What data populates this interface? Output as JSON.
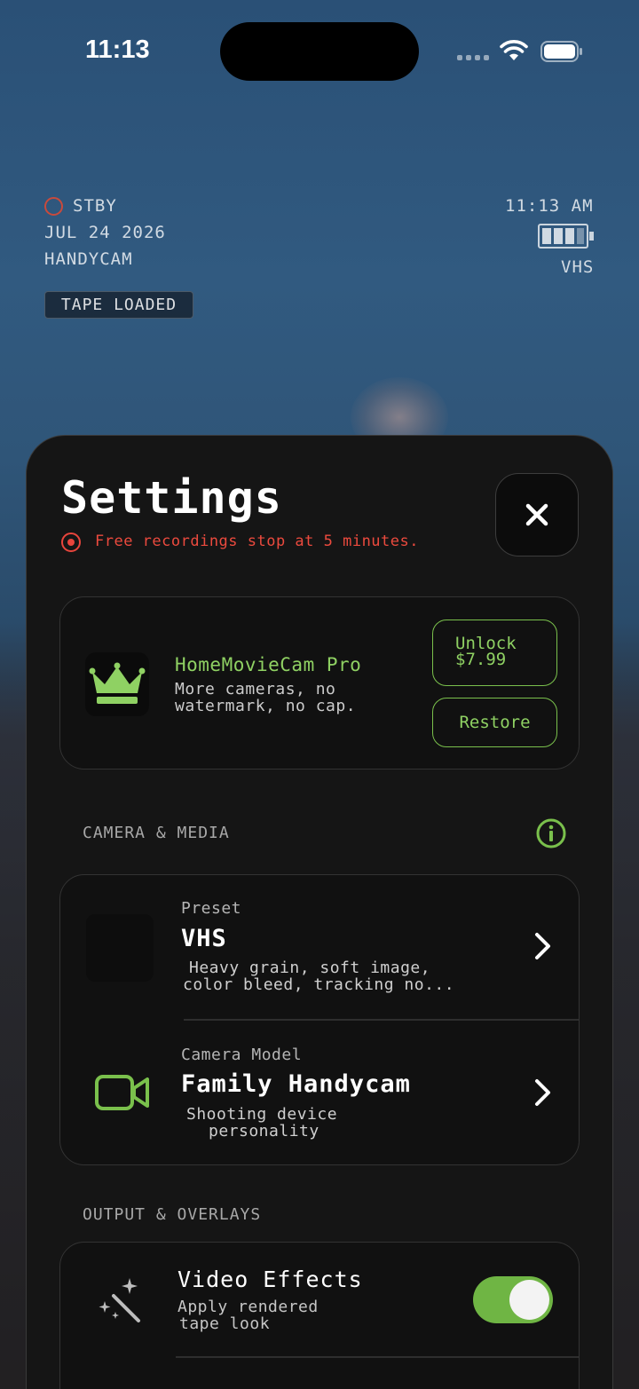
{
  "status_bar": {
    "time": "11:13"
  },
  "hud": {
    "mode": "STBY",
    "date": "JUL 24 2026",
    "camera": "HANDYCAM",
    "tape_badge": "TAPE LOADED",
    "clock": "11:13 AM",
    "format": "VHS"
  },
  "sheet": {
    "title": "Settings",
    "free_notice": "Free recordings stop at 5 minutes.",
    "pro": {
      "title": "HomeMovieCam Pro",
      "description": "More cameras, no watermark, no cap.",
      "unlock_label": "Unlock",
      "unlock_price": "$7.99",
      "restore_label": "Restore"
    },
    "camera_section": {
      "label": "CAMERA & MEDIA",
      "preset": {
        "label": "Preset",
        "value": "VHS",
        "description_line1": "Heavy grain, soft image,",
        "description_line2": "color bleed, tracking no..."
      },
      "camera_model": {
        "label": "Camera Model",
        "value": "Family Handycam",
        "description_line1": "Shooting device",
        "description_line2": "personality"
      }
    },
    "output_section": {
      "label": "OUTPUT & OVERLAYS",
      "video_effects": {
        "title": "Video Effects",
        "description_line1": "Apply rendered",
        "description_line2": "tape look",
        "enabled": true
      }
    }
  },
  "colors": {
    "accent_green": "#8fd163",
    "toggle_green": "#6fb544",
    "warning_red": "#ec4a3e",
    "sheet_bg": "#151515"
  },
  "icons": [
    "wifi-icon",
    "battery-icon",
    "close-icon",
    "crown-icon",
    "info-icon",
    "chevron-right-icon",
    "video-camera-icon",
    "magic-wand-icon"
  ]
}
